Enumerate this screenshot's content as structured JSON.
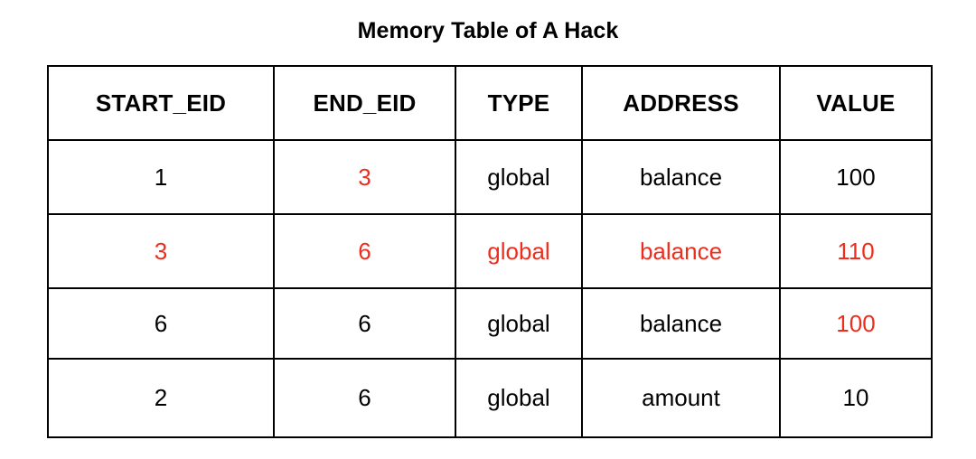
{
  "title": "Memory Table of A Hack",
  "colors": {
    "text": "#000000",
    "highlight": "#ED2E1E",
    "border": "#000000",
    "background": "#FFFFFF"
  },
  "table": {
    "columns": [
      {
        "key": "start_eid",
        "label": "START_EID"
      },
      {
        "key": "end_eid",
        "label": "END_EID"
      },
      {
        "key": "type",
        "label": "TYPE"
      },
      {
        "key": "address",
        "label": "ADDRESS"
      },
      {
        "key": "value",
        "label": "VALUE"
      }
    ],
    "rows": [
      {
        "start_eid": "1",
        "start_eid_color": "black",
        "end_eid": "3",
        "end_eid_color": "red",
        "type": "global",
        "type_color": "black",
        "address": "balance",
        "address_color": "black",
        "value": "100",
        "value_color": "black"
      },
      {
        "start_eid": "3",
        "start_eid_color": "red",
        "end_eid": "6",
        "end_eid_color": "red",
        "type": "global",
        "type_color": "red",
        "address": "balance",
        "address_color": "red",
        "value": "110",
        "value_color": "red"
      },
      {
        "start_eid": "6",
        "start_eid_color": "black",
        "end_eid": "6",
        "end_eid_color": "black",
        "type": "global",
        "type_color": "black",
        "address": "balance",
        "address_color": "black",
        "value": "100",
        "value_color": "red"
      },
      {
        "start_eid": "2",
        "start_eid_color": "black",
        "end_eid": "6",
        "end_eid_color": "black",
        "type": "global",
        "type_color": "black",
        "address": "amount",
        "address_color": "black",
        "value": "10",
        "value_color": "black"
      }
    ]
  }
}
